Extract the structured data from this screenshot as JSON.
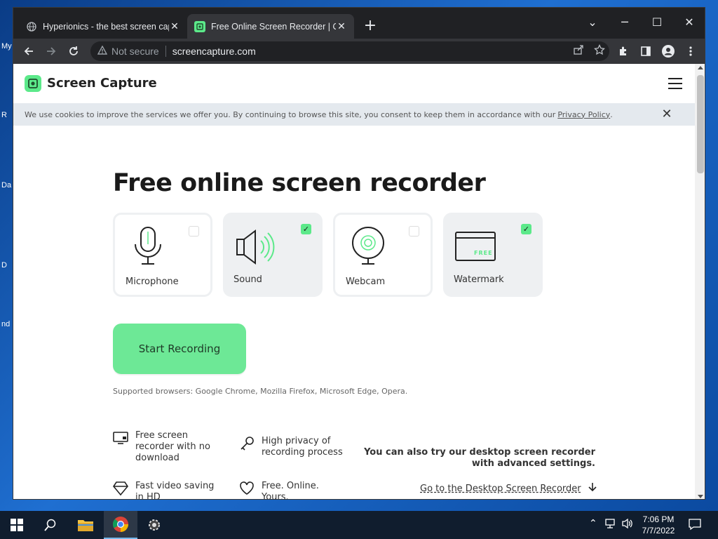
{
  "desktop": {
    "labels": [
      "My",
      "R",
      "Da",
      "D",
      "nd"
    ]
  },
  "browser": {
    "tabs": [
      {
        "title": "Hyperionics - the best screen cap",
        "active": false,
        "favicon": "globe-icon"
      },
      {
        "title": "Free Online Screen Recorder | Or",
        "active": true,
        "favicon": "screen-capture-favicon"
      }
    ],
    "new_tab": "+",
    "window_controls": {
      "collapse": "⌄",
      "minimize": "─",
      "maximize": "☐",
      "close": "✕"
    },
    "address_bar": {
      "security": "Not secure",
      "url": "screencapture.com"
    }
  },
  "page": {
    "logo_text": "Screen Capture",
    "cookie_banner": {
      "text": "We use cookies to improve the services we offer you. By continuing to browse this site, you consent to keep them in accordance with our",
      "link": "Privacy Policy",
      "end": "."
    },
    "headline": "Free online screen recorder",
    "options": [
      {
        "label": "Microphone",
        "checked": false,
        "icon": "microphone-icon"
      },
      {
        "label": "Sound",
        "checked": true,
        "icon": "speaker-icon"
      },
      {
        "label": "Webcam",
        "checked": false,
        "icon": "webcam-icon"
      },
      {
        "label": "Watermark",
        "checked": true,
        "icon": "watermark-icon",
        "badge": "FREE"
      }
    ],
    "start_button": "Start Recording",
    "supported": "Supported browsers: Google Chrome, Mozilla Firefox, Microsoft Edge, Opera.",
    "features": [
      {
        "lines": [
          "Free screen",
          "recorder with no",
          "download"
        ],
        "icon": "monitor-icon"
      },
      {
        "lines": [
          "High privacy of",
          "recording process"
        ],
        "icon": "key-icon"
      },
      {
        "lines": [
          "Fast video saving",
          "in HD"
        ],
        "icon": "diamond-icon"
      },
      {
        "lines": [
          "Free. Online.",
          "Yours."
        ],
        "icon": "heart-icon"
      }
    ],
    "desktop_promo": {
      "line1": "You can also try our desktop screen recorder",
      "line2": "with advanced settings."
    },
    "desktop_link": "Go to the Desktop Screen Recorder"
  },
  "taskbar": {
    "time": "7:06 PM",
    "date": "7/7/2022",
    "apps": [
      "windows-start-icon",
      "search-icon",
      "file-explorer-icon",
      "chrome-icon",
      "settings-gear-app-icon"
    ]
  },
  "colors": {
    "accent_green": "#5ce98a",
    "button_green": "#6de896",
    "chrome_dark": "#202124",
    "chrome_tab": "#35363a"
  }
}
